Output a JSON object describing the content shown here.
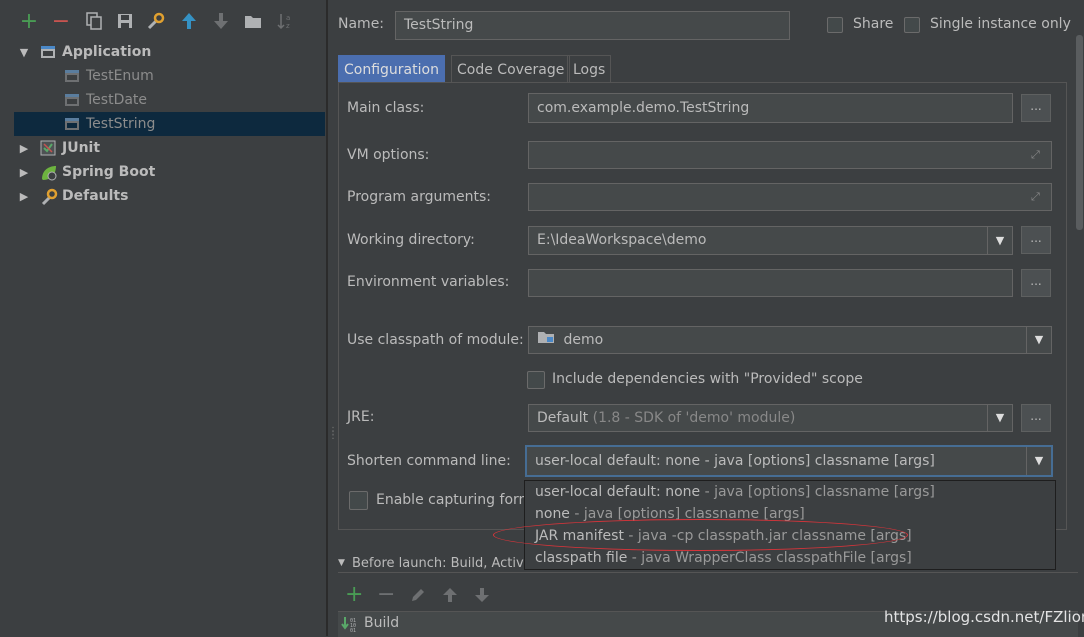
{
  "toolbar": {
    "add_icon": "+",
    "remove_icon": "−"
  },
  "tree": {
    "application": "Application",
    "test_enum": "TestEnum",
    "test_date": "TestDate",
    "test_string": "TestString",
    "junit": "JUnit",
    "spring_boot": "Spring Boot",
    "defaults": "Defaults"
  },
  "header": {
    "name_label": "Name:",
    "name_value": "TestString",
    "share_label": "Share",
    "single_instance_label": "Single instance only"
  },
  "tabs": [
    "Configuration",
    "Code Coverage",
    "Logs"
  ],
  "form": {
    "main_class_label": "Main class:",
    "main_class_value": "com.example.demo.TestString",
    "vm_options_label": "VM options:",
    "program_args_label": "Program arguments:",
    "working_dir_label": "Working directory:",
    "working_dir_value": "E:\\IdeaWorkspace\\demo",
    "env_vars_label": "Environment variables:",
    "classpath_label": "Use classpath of module:",
    "classpath_value": "demo",
    "include_deps_label": "Include dependencies with \"Provided\" scope",
    "jre_label": "JRE:",
    "jre_value": "Default",
    "jre_hint": "(1.8 - SDK of 'demo' module)",
    "shorten_label": "Shorten command line:",
    "shorten_value": "user-local default: none - java [options] classname [args]",
    "enable_capturing_label": "Enable capturing form",
    "dots": "..."
  },
  "dropdown_options": [
    {
      "name": "user-local default: none",
      "hint": " - java [options] classname [args]"
    },
    {
      "name": "none",
      "hint": " - java [options] classname [args]"
    },
    {
      "name": "JAR manifest",
      "hint": " - java -cp classpath.jar classname [args]"
    },
    {
      "name": "classpath file",
      "hint": " - java WrapperClass classpathFile [args]"
    }
  ],
  "before_launch": {
    "label": "Before launch: Build, Activat",
    "build_item": "Build"
  },
  "watermark": "https://blog.csdn.net/FZlion",
  "colors": {
    "background": "#3c3f41",
    "selection": "#0d293e",
    "accent": "#4b6eaf",
    "add_green": "#499c54",
    "remove_red": "#c75450",
    "highlight_red": "#d9343a"
  }
}
